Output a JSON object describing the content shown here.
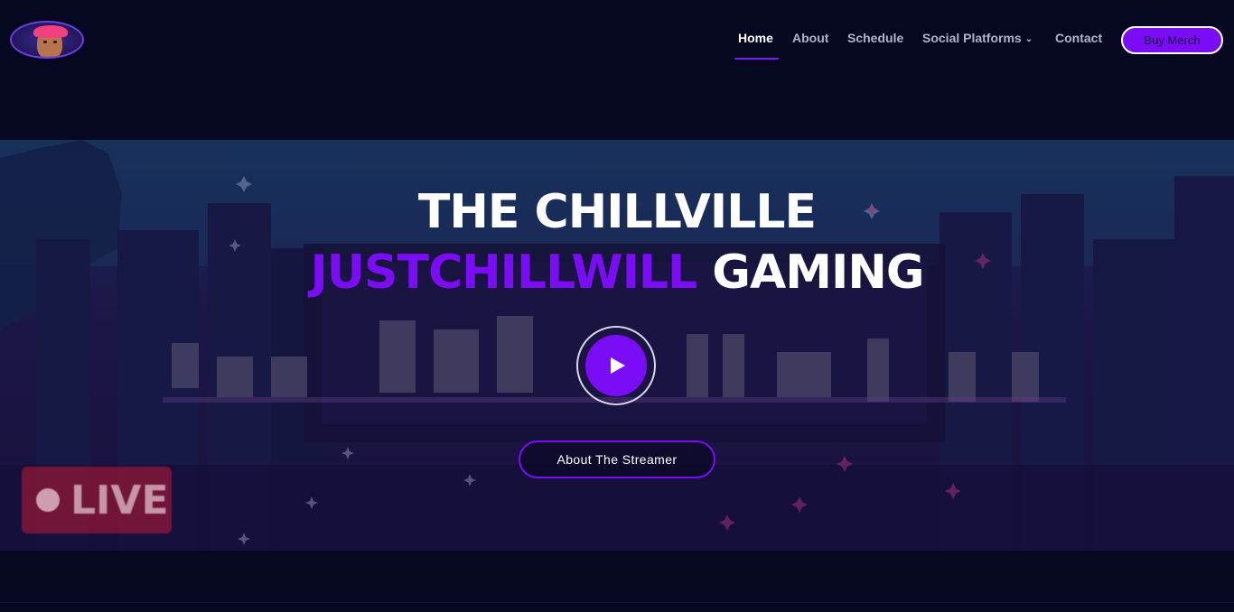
{
  "header": {
    "logo_alt": "streamer avatar logo",
    "nav": [
      {
        "label": "Home",
        "active": true
      },
      {
        "label": "About",
        "active": false
      },
      {
        "label": "Schedule",
        "active": false
      },
      {
        "label": "Social Platforms",
        "active": false,
        "has_dropdown": true
      },
      {
        "label": "Contact",
        "active": false
      }
    ],
    "merch_label": "Buy Merch"
  },
  "hero": {
    "title_line1": "THE CHILLVILLE",
    "title_line2_accent": "JUSTCHILLWILL",
    "title_line2_rest": "GAMING",
    "play_icon": "play-icon",
    "cta_label": "About The Streamer",
    "live_badge_text": "LIVE",
    "background_wordmark": "JustChillWill"
  },
  "colors": {
    "background": "#060720",
    "accent": "#7a0df5",
    "nav_text": "#b2b5c9",
    "nav_active": "#ffffff"
  }
}
